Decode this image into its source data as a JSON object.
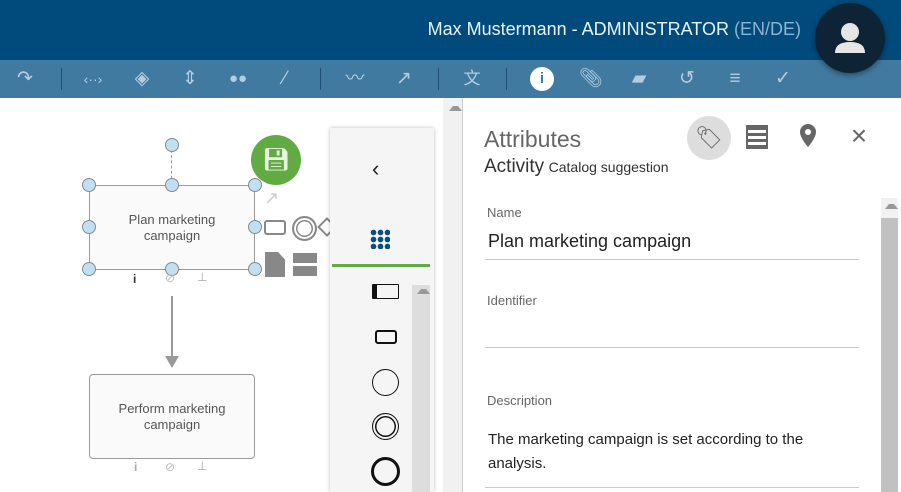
{
  "header": {
    "user": "Max Mustermann - ADMINISTRATOR",
    "lang": "(EN/DE)"
  },
  "toolbar": {
    "info_label": "i"
  },
  "canvas": {
    "nodes": [
      {
        "label": "Plan marketing campaign"
      },
      {
        "label": "Perform marketing campaign"
      }
    ],
    "info_label": "i"
  },
  "panel": {
    "title": "Attributes",
    "type": "Activity",
    "subtype": "Catalog suggestion",
    "fields": [
      {
        "label": "Name",
        "value": "Plan marketing campaign"
      },
      {
        "label": "Identifier",
        "value": ""
      },
      {
        "label": "Description",
        "value": "The marketing campaign is set according to the analysis."
      }
    ]
  },
  "colors": {
    "header": "#004b7c",
    "toolbar": "#417aa0",
    "save": "#62ab44",
    "palette_active": "#62ab44"
  }
}
